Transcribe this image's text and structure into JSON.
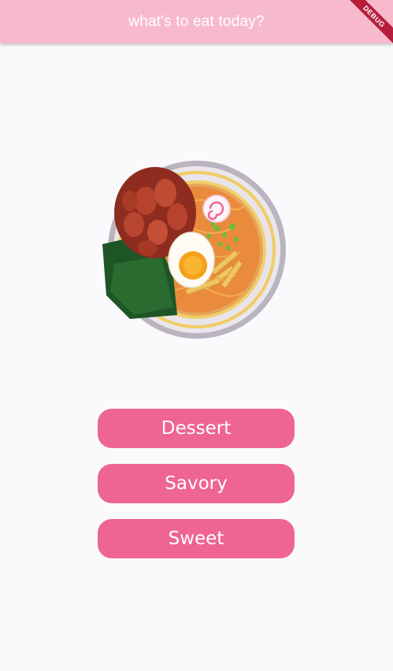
{
  "app_bar": {
    "title": "what's to eat today?"
  },
  "debug_banner": {
    "label": "DEBUG"
  },
  "image": {
    "subject": "ramen-bowl-illustration"
  },
  "buttons": [
    {
      "label": "Dessert"
    },
    {
      "label": "Savory"
    },
    {
      "label": "Sweet"
    }
  ],
  "colors": {
    "app_bar": "#f7bacd",
    "button": "#ee6493",
    "background": "#faf9fb",
    "debug_ribbon": "#b71c3b"
  }
}
